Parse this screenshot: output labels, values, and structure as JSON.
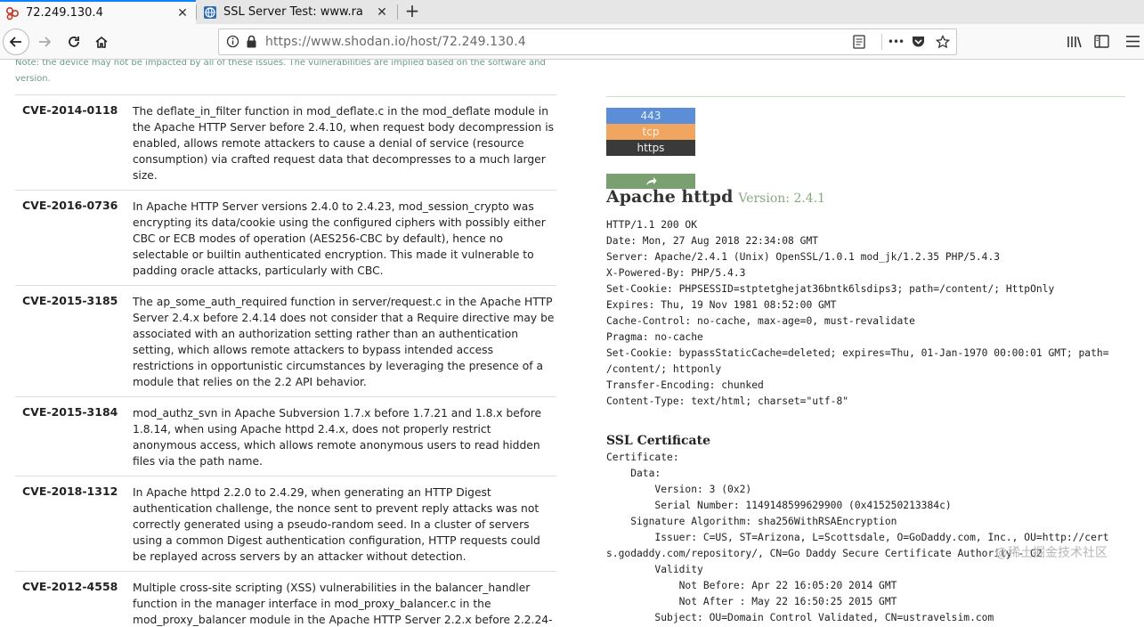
{
  "browser": {
    "tabs": [
      {
        "title": "72.249.130.4",
        "icon": "shodan-icon",
        "active": true
      },
      {
        "title": "SSL Server Test: www.ra",
        "icon": "ssl-globe-icon",
        "active": false
      }
    ],
    "new_tab": "+",
    "close_glyph": "✕",
    "url_scheme_host": "https://www.shodan.io",
    "url_path": "/host/72.249.130.4",
    "menu_dots": "•••"
  },
  "page": {
    "note": "Note: the device may not be impacted by all of these issues. The vulnerabilities are implied based on the software and version.",
    "vulns": [
      {
        "id": "CVE-2014-0118",
        "desc": "The deflate_in_filter function in mod_deflate.c in the mod_deflate module in the Apache HTTP Server before 2.4.10, when request body decompression is enabled, allows remote attackers to cause a denial of service (resource consumption) via crafted request data that decompresses to a much larger size."
      },
      {
        "id": "CVE-2016-0736",
        "desc": "In Apache HTTP Server versions 2.4.0 to 2.4.23, mod_session_crypto was encrypting its data/cookie using the configured ciphers with possibly either CBC or ECB modes of operation (AES256-CBC by default), hence no selectable or builtin authenticated encryption. This made it vulnerable to padding oracle attacks, particularly with CBC."
      },
      {
        "id": "CVE-2015-3185",
        "desc": "The ap_some_auth_required function in server/request.c in the Apache HTTP Server 2.4.x before 2.4.14 does not consider that a Require directive may be associated with an authorization setting rather than an authentication setting, which allows remote attackers to bypass intended access restrictions in opportunistic circumstances by leveraging the presence of a module that relies on the 2.2 API behavior."
      },
      {
        "id": "CVE-2015-3184",
        "desc": "mod_authz_svn in Apache Subversion 1.7.x before 1.7.21 and 1.8.x before 1.8.14, when using Apache httpd 2.4.x, does not properly restrict anonymous access, which allows remote anonymous users to read hidden files via the path name."
      },
      {
        "id": "CVE-2018-1312",
        "desc": "In Apache httpd 2.2.0 to 2.4.29, when generating an HTTP Digest authentication challenge, the nonce sent to prevent reply attacks was not correctly generated using a pseudo-random seed. In a cluster of servers using a common Digest authentication configuration, HTTP requests could be replayed across servers by an attacker without detection."
      },
      {
        "id": "CVE-2012-4558",
        "desc": "Multiple cross-site scripting (XSS) vulnerabilities in the balancer_handler function in the manager interface in mod_proxy_balancer.c in the mod_proxy_balancer module in the Apache HTTP Server 2.2.x before 2.2.24-"
      }
    ],
    "service": {
      "port": "443",
      "protocol": "tcp",
      "name": "https",
      "product": "Apache httpd",
      "version": "Version: 2.4.1",
      "banner": "HTTP/1.1 200 OK\nDate: Mon, 27 Aug 2018 22:34:08 GMT\nServer: Apache/2.4.1 (Unix) OpenSSL/1.0.1 mod_jk/1.2.35 PHP/5.4.3\nX-Powered-By: PHP/5.4.3\nSet-Cookie: PHPSESSID=stptetghejat36bntk6lsdips3; path=/content/; HttpOnly\nExpires: Thu, 19 Nov 1981 08:52:00 GMT\nCache-Control: no-cache, max-age=0, must-revalidate\nPragma: no-cache\nSet-Cookie: bypassStaticCache=deleted; expires=Thu, 01-Jan-1970 00:00:01 GMT; path=\n/content/; httponly\nTransfer-Encoding: chunked\nContent-Type: text/html; charset=\"utf-8\"",
      "ssl_heading": "SSL Certificate",
      "certificate": "Certificate:\n    Data:\n        Version: 3 (0x2)\n        Serial Number: 1149148599629900 (0x415250213384c)\n    Signature Algorithm: sha256WithRSAEncryption\n        Issuer: C=US, ST=Arizona, L=Scottsdale, O=GoDaddy.com, Inc., OU=http://cert\ns.godaddy.com/repository/, CN=Go Daddy Secure Certificate Authority - G2\n        Validity\n            Not Before: Apr 22 16:05:20 2014 GMT\n            Not After : May 22 16:50:25 2015 GMT\n        Subject: OU=Domain Control Validated, CN=ustravelsim.com"
    }
  },
  "watermark": "@稀土掘金技术社区"
}
